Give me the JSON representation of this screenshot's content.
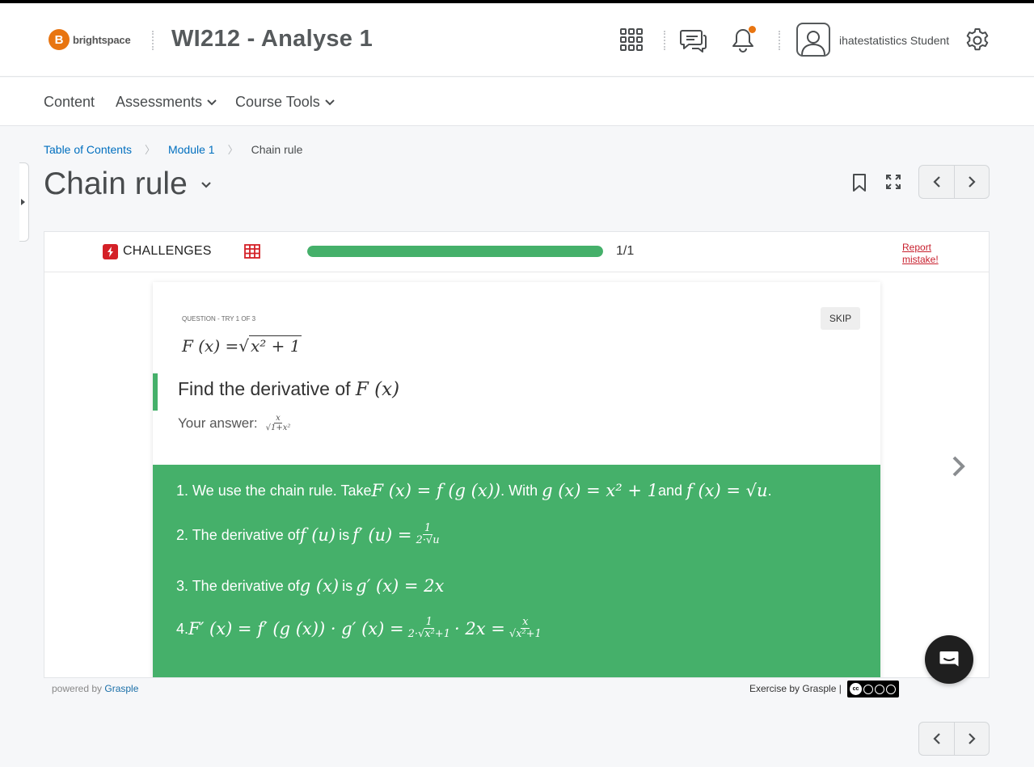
{
  "header": {
    "logo_letter": "B",
    "logo_text": "brightspace",
    "course_title": "WI212 - Analyse 1",
    "username": "ihatestatistics Student",
    "notification_dot_color": "#e87511"
  },
  "nav": {
    "items": [
      {
        "label": "Content"
      },
      {
        "label": "Assessments"
      },
      {
        "label": "Course Tools"
      }
    ]
  },
  "breadcrumb": {
    "items": [
      "Table of Contents",
      "Module 1"
    ],
    "current": "Chain rule"
  },
  "page": {
    "title": "Chain rule"
  },
  "challenge": {
    "label": "CHALLENGES",
    "progress_fraction": 1.0,
    "progress_text": "1/1",
    "report_label_1": "Report",
    "report_label_2": "mistake!",
    "accent_color": "#45b06a"
  },
  "question": {
    "try_label": "QUESTION - TRY 1 OF 3",
    "skip_label": "SKIP",
    "formula_lhs": "F (x) = ",
    "formula_radicand": "x² + 1",
    "prompt_text": "Find the derivative of ",
    "prompt_math": "F (x)",
    "answer_label": "Your answer:",
    "answer_num": "x",
    "answer_den": "√1+x²"
  },
  "solution": {
    "step1": {
      "t1": "1. We use the chain rule. Take ",
      "m1": "F (x) = f (g (x))",
      "t2": ". With ",
      "m2": "g (x) = x² + 1",
      "t3": " and ",
      "m3": "f (x) = √u",
      "t4": "."
    },
    "step2": {
      "t1": "2. The derivative of ",
      "m1": "f (u)",
      "t2": " is ",
      "m2": "f′ (u) = ",
      "frac_num": "1",
      "frac_den": "2·√u"
    },
    "step3": {
      "t1": "3. The derivative of ",
      "m1": "g (x)",
      "t2": " is ",
      "m2": "g′ (x) = 2x"
    },
    "step4": {
      "t1": "4. ",
      "m1": "F′ (x) = f′ (g (x)) · g′ (x) = ",
      "f1_num": "1",
      "f1_den": "2·√x²+1",
      "m2": " · 2x = ",
      "f2_num": "x",
      "f2_den": "√x²+1"
    }
  },
  "footer": {
    "powered_prefix": "powered by ",
    "powered_brand": "Grasple",
    "exercise_by": "Exercise by Grasple |",
    "license_text": "cc"
  }
}
